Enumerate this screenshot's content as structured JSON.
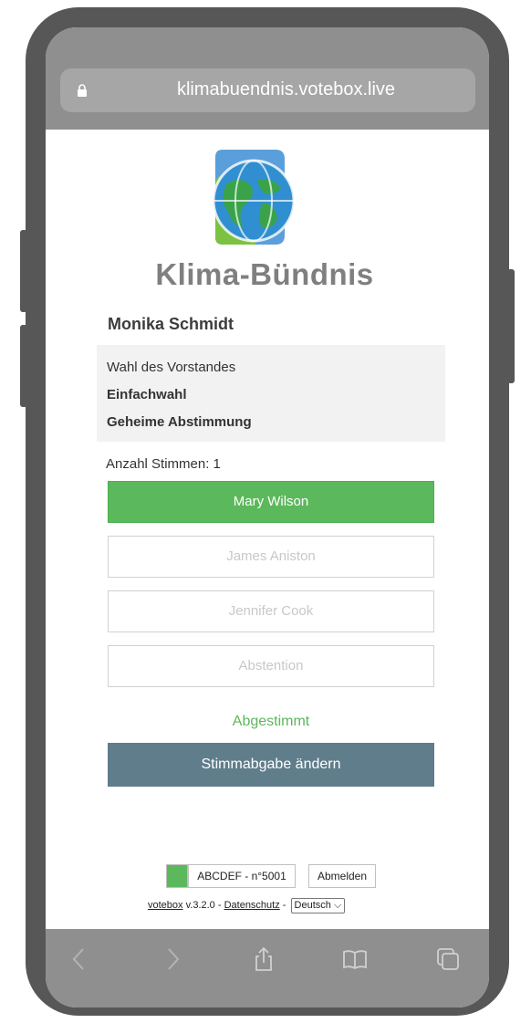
{
  "browser": {
    "url": "klimabuendnis.votebox.live"
  },
  "logo": {
    "wordmark": "Klima-Bündnis"
  },
  "voter": {
    "name": "Monika Schmidt"
  },
  "ballot": {
    "title": "Wahl des Vorstandes",
    "type": "Einfachwahl",
    "mode": "Geheime Abstimmung",
    "votes_label": "Anzahl Stimmen: 1"
  },
  "options": [
    {
      "label": "Mary Wilson",
      "selected": true
    },
    {
      "label": "James Aniston",
      "selected": false
    },
    {
      "label": "Jennifer Cook",
      "selected": false
    },
    {
      "label": "Abstention",
      "selected": false
    }
  ],
  "status_text": "Abgestimmt",
  "change_button": "Stimmabgabe ändern",
  "footer": {
    "code": "ABCDEF - n°5001",
    "logout": "Abmelden",
    "brand_link": "votebox",
    "version": " v.3.2.0 - ",
    "privacy_link": "Datenschutz",
    "sep": " - ",
    "language": "Deutsch"
  },
  "colors": {
    "accent_green": "#5cb85c",
    "button_slate": "#607d8b",
    "frame": "#575757"
  },
  "icons": {
    "lock": "lock-icon",
    "back": "chevron-left-icon",
    "forward": "chevron-right-icon",
    "share": "share-icon",
    "bookmarks": "book-icon",
    "tabs": "tabs-icon"
  }
}
